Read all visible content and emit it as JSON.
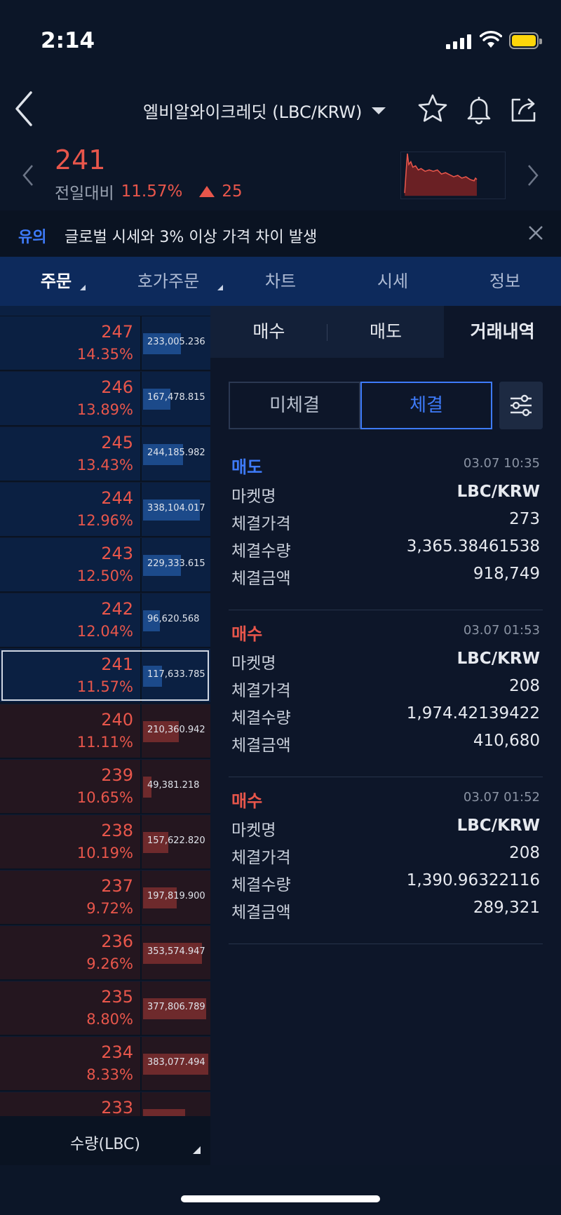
{
  "status": {
    "time": "2:14"
  },
  "header": {
    "title": "엘비알와이크레딧 (LBC/KRW)"
  },
  "price": {
    "current": "241",
    "label": "전일대비",
    "change_pct": "11.57%",
    "change_abs": "25"
  },
  "notice": {
    "tag": "유의",
    "text": "글로벌 시세와 3% 이상 가격 차이 발생"
  },
  "main_tabs": [
    {
      "label": "주문",
      "active": true
    },
    {
      "label": "호가주문",
      "active": false
    },
    {
      "label": "차트",
      "active": false
    },
    {
      "label": "시세",
      "active": false
    },
    {
      "label": "정보",
      "active": false
    }
  ],
  "orderbook": {
    "rows": [
      {
        "side": "ask",
        "price": "247",
        "pct": "14.35%",
        "qty": "233,005.236",
        "fill": 0.18
      },
      {
        "side": "ask",
        "price": "246",
        "pct": "13.89%",
        "qty": "167,478.815",
        "fill": 0.13
      },
      {
        "side": "ask",
        "price": "245",
        "pct": "13.43%",
        "qty": "244,185.982",
        "fill": 0.19
      },
      {
        "side": "ask",
        "price": "244",
        "pct": "12.96%",
        "qty": "338,104.017",
        "fill": 0.27
      },
      {
        "side": "ask",
        "price": "243",
        "pct": "12.50%",
        "qty": "229,333.615",
        "fill": 0.18
      },
      {
        "side": "ask",
        "price": "242",
        "pct": "12.04%",
        "qty": "96,620.568",
        "fill": 0.08
      },
      {
        "side": "ask",
        "price": "241",
        "pct": "11.57%",
        "qty": "117,633.785",
        "fill": 0.09,
        "current": true
      },
      {
        "side": "bid",
        "price": "240",
        "pct": "11.11%",
        "qty": "210,360.942",
        "fill": 0.17
      },
      {
        "side": "bid",
        "price": "239",
        "pct": "10.65%",
        "qty": "49,381.218",
        "fill": 0.04
      },
      {
        "side": "bid",
        "price": "238",
        "pct": "10.19%",
        "qty": "157,622.820",
        "fill": 0.12
      },
      {
        "side": "bid",
        "price": "237",
        "pct": "9.72%",
        "qty": "197,819.900",
        "fill": 0.16
      },
      {
        "side": "bid",
        "price": "236",
        "pct": "9.26%",
        "qty": "353,574.947",
        "fill": 0.28
      },
      {
        "side": "bid",
        "price": "235",
        "pct": "8.80%",
        "qty": "377,806.789",
        "fill": 0.3
      },
      {
        "side": "bid",
        "price": "234",
        "pct": "8.33%",
        "qty": "383,077.494",
        "fill": 0.31
      },
      {
        "side": "bid",
        "price": "233",
        "pct": "",
        "qty": "",
        "fill": 0.2
      }
    ],
    "footer_label": "수량(LBC)"
  },
  "sub_tabs": [
    {
      "label": "매수",
      "active": false
    },
    {
      "label": "매도",
      "active": false
    },
    {
      "label": "거래내역",
      "active": true
    }
  ],
  "segment": [
    {
      "label": "미체결",
      "active": false
    },
    {
      "label": "체결",
      "active": true
    }
  ],
  "trades": [
    {
      "side": "매도",
      "side_type": "sell",
      "time": "03.07 10:35",
      "rows": [
        {
          "k": "마켓명",
          "v": "LBC/KRW"
        },
        {
          "k": "체결가격",
          "v": "273"
        },
        {
          "k": "체결수량",
          "v": "3,365.38461538"
        },
        {
          "k": "체결금액",
          "v": "918,749"
        }
      ]
    },
    {
      "side": "매수",
      "side_type": "buy",
      "time": "03.07 01:53",
      "rows": [
        {
          "k": "마켓명",
          "v": "LBC/KRW"
        },
        {
          "k": "체결가격",
          "v": "208"
        },
        {
          "k": "체결수량",
          "v": "1,974.42139422"
        },
        {
          "k": "체결금액",
          "v": "410,680"
        }
      ]
    },
    {
      "side": "매수",
      "side_type": "buy",
      "time": "03.07 01:52",
      "rows": [
        {
          "k": "마켓명",
          "v": "LBC/KRW"
        },
        {
          "k": "체결가격",
          "v": "208"
        },
        {
          "k": "체결수량",
          "v": "1,390.96322116"
        },
        {
          "k": "체결금액",
          "v": "289,321"
        }
      ]
    }
  ],
  "colors": {
    "up": "#e8564b",
    "down": "#3e7bfa",
    "accent": "#3e7bfa",
    "tab_bar": "#0d2a5c"
  }
}
